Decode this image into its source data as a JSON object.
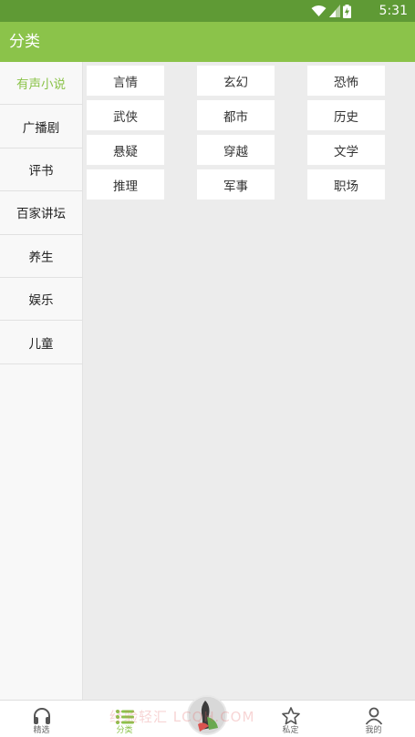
{
  "status_bar": {
    "time": "5:31"
  },
  "app_bar": {
    "title": "分类"
  },
  "sidebar": {
    "items": [
      {
        "label": "有声小说"
      },
      {
        "label": "广播剧"
      },
      {
        "label": "评书"
      },
      {
        "label": "百家讲坛"
      },
      {
        "label": "养生"
      },
      {
        "label": "娱乐"
      },
      {
        "label": "儿童"
      }
    ]
  },
  "categories": [
    "言情",
    "玄幻",
    "恐怖",
    "武侠",
    "都市",
    "历史",
    "悬疑",
    "穿越",
    "文学",
    "推理",
    "军事",
    "职场"
  ],
  "bottom_nav": {
    "items": [
      {
        "label": "精选",
        "icon": "headphones-icon"
      },
      {
        "label": "分类",
        "icon": "list-icon"
      },
      {
        "label": "私定",
        "icon": "star-icon"
      },
      {
        "label": "我的",
        "icon": "person-icon"
      }
    ]
  },
  "watermark": "经验轻汇 LCQH.COM",
  "colors": {
    "accent": "#8bc34a",
    "status_bar": "#5f9a35",
    "background": "#ececec"
  }
}
